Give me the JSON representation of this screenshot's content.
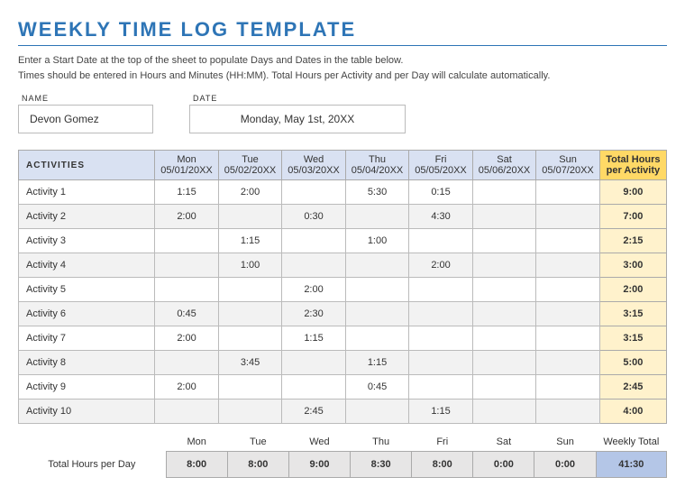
{
  "title": "WEEKLY TIME LOG TEMPLATE",
  "instructions_line1": "Enter a Start Date at the top of the sheet to populate Days and Dates in the table below.",
  "instructions_line2": "Times should be entered in Hours and Minutes (HH:MM).  Total Hours per Activity and per Day will calculate automatically.",
  "meta": {
    "name_label": "NAME",
    "name_value": "Devon Gomez",
    "date_label": "DATE",
    "date_value": "Monday, May 1st, 20XX"
  },
  "headers": {
    "activities": "ACTIVITIES",
    "total_per_activity": "Total Hours per Activity",
    "days": [
      {
        "dow": "Mon",
        "date": "05/01/20XX"
      },
      {
        "dow": "Tue",
        "date": "05/02/20XX"
      },
      {
        "dow": "Wed",
        "date": "05/03/20XX"
      },
      {
        "dow": "Thu",
        "date": "05/04/20XX"
      },
      {
        "dow": "Fri",
        "date": "05/05/20XX"
      },
      {
        "dow": "Sat",
        "date": "05/06/20XX"
      },
      {
        "dow": "Sun",
        "date": "05/07/20XX"
      }
    ]
  },
  "rows": [
    {
      "activity": "Activity 1",
      "cells": [
        "1:15",
        "2:00",
        "",
        "5:30",
        "0:15",
        "",
        ""
      ],
      "total": "9:00"
    },
    {
      "activity": "Activity 2",
      "cells": [
        "2:00",
        "",
        "0:30",
        "",
        "4:30",
        "",
        ""
      ],
      "total": "7:00"
    },
    {
      "activity": "Activity 3",
      "cells": [
        "",
        "1:15",
        "",
        "1:00",
        "",
        "",
        ""
      ],
      "total": "2:15"
    },
    {
      "activity": "Activity 4",
      "cells": [
        "",
        "1:00",
        "",
        "",
        "2:00",
        "",
        ""
      ],
      "total": "3:00"
    },
    {
      "activity": "Activity 5",
      "cells": [
        "",
        "",
        "2:00",
        "",
        "",
        "",
        ""
      ],
      "total": "2:00"
    },
    {
      "activity": "Activity 6",
      "cells": [
        "0:45",
        "",
        "2:30",
        "",
        "",
        "",
        ""
      ],
      "total": "3:15"
    },
    {
      "activity": "Activity 7",
      "cells": [
        "2:00",
        "",
        "1:15",
        "",
        "",
        "",
        ""
      ],
      "total": "3:15"
    },
    {
      "activity": "Activity 8",
      "cells": [
        "",
        "3:45",
        "",
        "1:15",
        "",
        "",
        ""
      ],
      "total": "5:00"
    },
    {
      "activity": "Activity 9",
      "cells": [
        "2:00",
        "",
        "",
        "0:45",
        "",
        "",
        ""
      ],
      "total": "2:45"
    },
    {
      "activity": "Activity 10",
      "cells": [
        "",
        "",
        "2:45",
        "",
        "1:15",
        "",
        ""
      ],
      "total": "4:00"
    }
  ],
  "footer": {
    "label": "Total Hours per Day",
    "day_labels": [
      "Mon",
      "Tue",
      "Wed",
      "Thu",
      "Fri",
      "Sat",
      "Sun"
    ],
    "weekly_label": "Weekly Total",
    "totals": [
      "8:00",
      "8:00",
      "9:00",
      "8:30",
      "8:00",
      "0:00",
      "0:00"
    ],
    "grand_total": "41:30"
  },
  "chart_data": {
    "type": "table",
    "title": "Weekly Time Log",
    "columns": [
      "Activity",
      "Mon 05/01/20XX",
      "Tue 05/02/20XX",
      "Wed 05/03/20XX",
      "Thu 05/04/20XX",
      "Fri 05/05/20XX",
      "Sat 05/06/20XX",
      "Sun 05/07/20XX",
      "Total Hours per Activity"
    ],
    "rows": [
      [
        "Activity 1",
        "1:15",
        "2:00",
        "",
        "5:30",
        "0:15",
        "",
        "",
        "9:00"
      ],
      [
        "Activity 2",
        "2:00",
        "",
        "0:30",
        "",
        "4:30",
        "",
        "",
        "7:00"
      ],
      [
        "Activity 3",
        "",
        "1:15",
        "",
        "1:00",
        "",
        "",
        "",
        "2:15"
      ],
      [
        "Activity 4",
        "",
        "1:00",
        "",
        "",
        "2:00",
        "",
        "",
        "3:00"
      ],
      [
        "Activity 5",
        "",
        "",
        "2:00",
        "",
        "",
        "",
        "",
        "2:00"
      ],
      [
        "Activity 6",
        "0:45",
        "",
        "2:30",
        "",
        "",
        "",
        "",
        "3:15"
      ],
      [
        "Activity 7",
        "2:00",
        "",
        "1:15",
        "",
        "",
        "",
        "",
        "3:15"
      ],
      [
        "Activity 8",
        "",
        "3:45",
        "",
        "1:15",
        "",
        "",
        "",
        "5:00"
      ],
      [
        "Activity 9",
        "2:00",
        "",
        "",
        "0:45",
        "",
        "",
        "",
        "2:45"
      ],
      [
        "Activity 10",
        "",
        "",
        "2:45",
        "",
        "1:15",
        "",
        "",
        "4:00"
      ]
    ],
    "footer": [
      "Total Hours per Day",
      "8:00",
      "8:00",
      "9:00",
      "8:30",
      "8:00",
      "0:00",
      "0:00",
      "41:30"
    ]
  }
}
